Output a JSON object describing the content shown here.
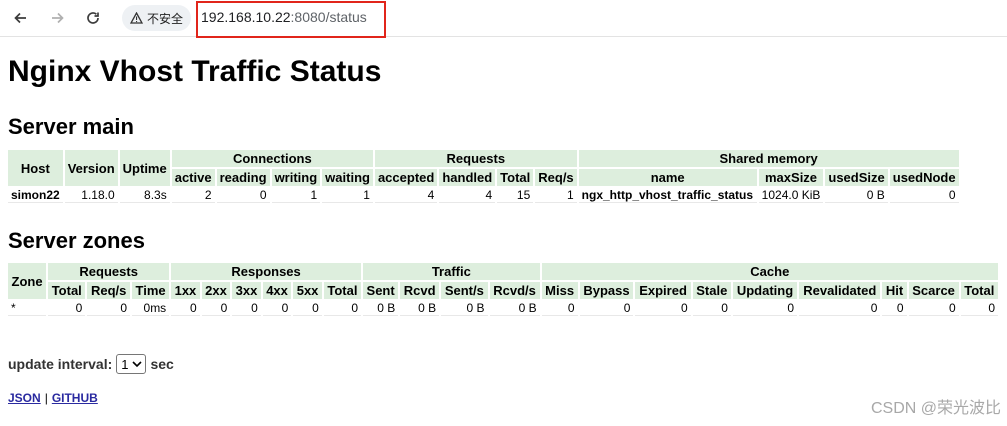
{
  "browser": {
    "security_label": "不安全",
    "url_host": "192.168.10.22",
    "url_rest": ":8080/status"
  },
  "page": {
    "title": "Nginx Vhost Traffic Status",
    "server_main": {
      "heading": "Server main",
      "groups": {
        "connections": "Connections",
        "requests": "Requests",
        "shared_memory": "Shared memory"
      },
      "headers": {
        "host": "Host",
        "version": "Version",
        "uptime": "Uptime"
      },
      "sub_headers": [
        "active",
        "reading",
        "writing",
        "waiting",
        "accepted",
        "handled",
        "Total",
        "Req/s",
        "name",
        "maxSize",
        "usedSize",
        "usedNode"
      ],
      "row": {
        "host": "simon22",
        "version": "1.18.0",
        "uptime": "8.3s",
        "active": "2",
        "reading": "0",
        "writing": "1",
        "waiting": "1",
        "accepted": "4",
        "handled": "4",
        "total": "15",
        "reqs": "1",
        "name": "ngx_http_vhost_traffic_status",
        "maxsize": "1024.0 KiB",
        "usedsize": "0 B",
        "usednode": "0"
      }
    },
    "server_zones": {
      "heading": "Server zones",
      "groups": {
        "zone": "Zone",
        "requests": "Requests",
        "responses": "Responses",
        "traffic": "Traffic",
        "cache": "Cache"
      },
      "sub_headers": [
        "Total",
        "Req/s",
        "Time",
        "1xx",
        "2xx",
        "3xx",
        "4xx",
        "5xx",
        "Total",
        "Sent",
        "Rcvd",
        "Sent/s",
        "Rcvd/s",
        "Miss",
        "Bypass",
        "Expired",
        "Stale",
        "Updating",
        "Revalidated",
        "Hit",
        "Scarce",
        "Total"
      ],
      "row": [
        "*",
        "0",
        "0",
        "0ms",
        "0",
        "0",
        "0",
        "0",
        "0",
        "0",
        "0 B",
        "0 B",
        "0 B",
        "0 B",
        "0",
        "0",
        "0",
        "0",
        "0",
        "0",
        "0",
        "0",
        "0"
      ]
    },
    "update_interval": {
      "label": "update interval:",
      "value": "1",
      "unit": "sec"
    },
    "links": {
      "json": "JSON",
      "github": "GITHUB"
    }
  },
  "watermark": "CSDN @荣光波比"
}
